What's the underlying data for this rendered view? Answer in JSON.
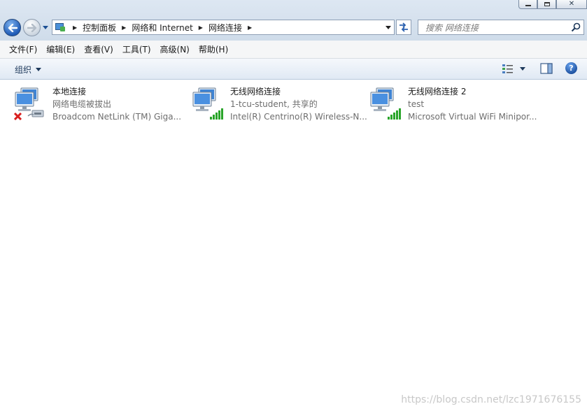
{
  "window": {
    "caption": {
      "close_glyph": "✕"
    }
  },
  "address_bar": {
    "breadcrumbs": [
      "控制面板",
      "网络和 Internet",
      "网络连接"
    ]
  },
  "search": {
    "placeholder": "搜索 网络连接"
  },
  "menu": {
    "items": [
      "文件(F)",
      "编辑(E)",
      "查看(V)",
      "工具(T)",
      "高级(N)",
      "帮助(H)"
    ]
  },
  "command_bar": {
    "organize_label": "组织",
    "help_glyph": "?"
  },
  "connections": [
    {
      "name": "本地连接",
      "status": "网络电缆被拔出",
      "device": "Broadcom NetLink (TM) Giga...",
      "icon": "wired-disconnected",
      "status_color": "#d81e1e"
    },
    {
      "name": "无线网络连接",
      "status": "1-tcu-student, 共享的",
      "device": "Intel(R) Centrino(R) Wireless-N...",
      "icon": "wireless-connected",
      "status_color": "#2aa52a"
    },
    {
      "name": "无线网络连接 2",
      "status": "test",
      "device": "Microsoft Virtual WiFi Minipor...",
      "icon": "wireless-connected",
      "status_color": "#2aa52a"
    }
  ],
  "watermark": "https://blog.csdn.net/lzc1971676155"
}
